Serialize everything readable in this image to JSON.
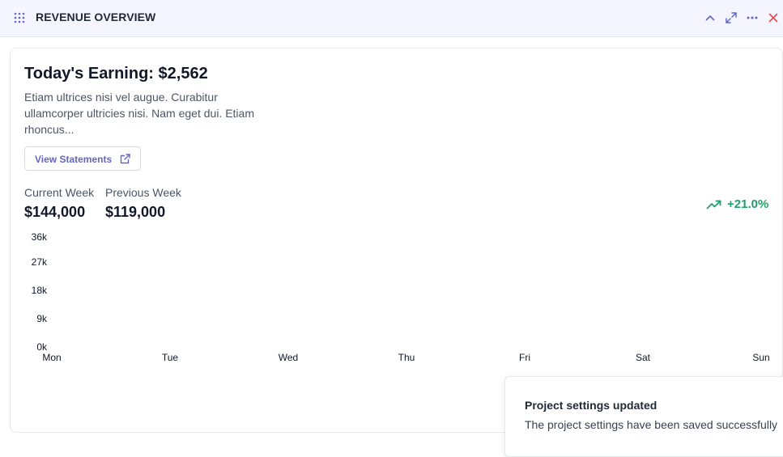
{
  "header": {
    "title": "REVENUE OVERVIEW",
    "icons": [
      "drag-handle-icon",
      "chevron-up-icon",
      "expand-icon",
      "more-horizontal-icon",
      "close-icon"
    ]
  },
  "card": {
    "earning_title": "Today's Earning: $2,562",
    "description": "Etiam ultrices nisi vel augue. Curabitur ullamcorper ultricies nisi. Nam eget dui. Etiam rhoncus...",
    "view_statements_label": "View Statements",
    "view_statements_icon": "external-link-icon",
    "current_week": {
      "label": "Current Week",
      "value": "$144,000"
    },
    "previous_week": {
      "label": "Previous Week",
      "value": "$119,000"
    },
    "trend": {
      "icon": "trending-up-icon",
      "text": "+21.0%",
      "color": "#22a06b"
    }
  },
  "chart_data": {
    "type": "bar",
    "categories": [
      "Mon",
      "Tue",
      "Wed",
      "Thu",
      "Fri",
      "Sat",
      "Sun"
    ],
    "yticks": [
      "0k",
      "9k",
      "18k",
      "27k",
      "36k"
    ],
    "ylim": [
      0,
      36000
    ],
    "series": []
  },
  "toast": {
    "title": "Project settings updated",
    "message": "The project settings have been saved successfully"
  },
  "colors": {
    "accent": "#6366c5",
    "close": "#e5484d",
    "positive": "#22a06b",
    "header_bg": "#f5f5ff"
  }
}
